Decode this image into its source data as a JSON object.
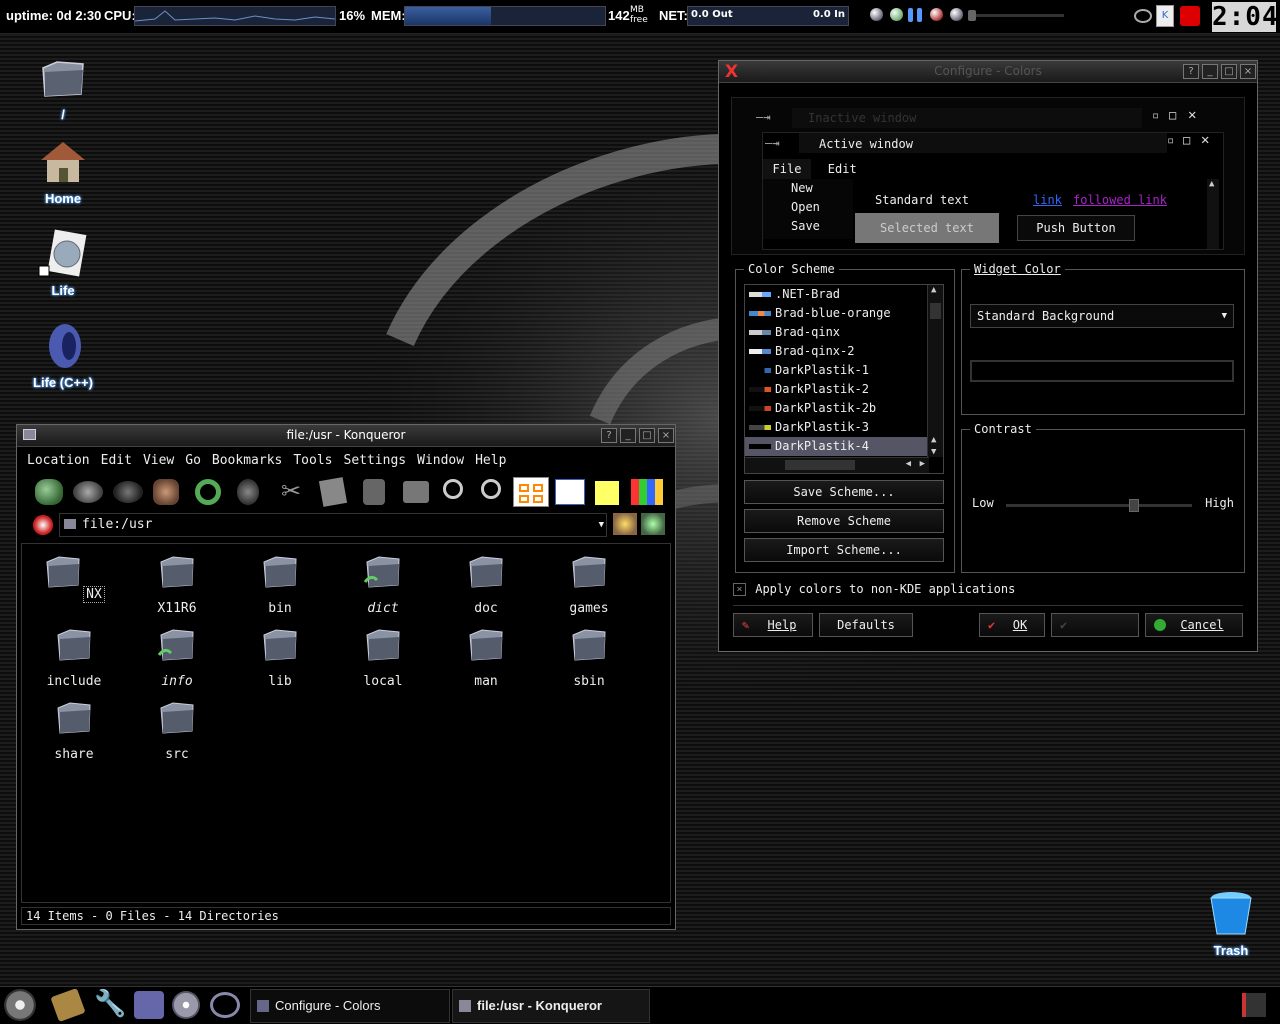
{
  "topbar": {
    "uptime": "uptime: 0d 2:30",
    "cpu_label": "CPU:",
    "cpu_value": "16%",
    "cpu_fraction": 0.16,
    "mem_label": "MEM:",
    "mem_value": "142",
    "mem_unit_top": "MB",
    "mem_unit_bottom": "free",
    "net_label": "NET:",
    "net_out": "0.0 Out",
    "net_in": "0.0 In",
    "clock": "2:04"
  },
  "desktop_icons": [
    {
      "label": "/",
      "icon": "folder-icon"
    },
    {
      "label": "Home",
      "icon": "home-icon"
    },
    {
      "label": "Life",
      "icon": "html-file-icon"
    },
    {
      "label": "Life (C++)",
      "icon": "program-icon"
    },
    {
      "label": "Trash",
      "icon": "trash-icon"
    }
  ],
  "konqueror": {
    "title": "file:/usr - Konqueror",
    "menu": [
      "Location",
      "Edit",
      "View",
      "Go",
      "Bookmarks",
      "Tools",
      "Settings",
      "Window",
      "Help"
    ],
    "location": "file:/usr",
    "folders": [
      "NX",
      "X11R6",
      "bin",
      "dict",
      "doc",
      "games",
      "include",
      "info",
      "lib",
      "local",
      "man",
      "sbin",
      "share",
      "src"
    ],
    "status": "14 Items - 0 Files - 14 Directories"
  },
  "colors": {
    "title": "Configure - Colors",
    "preview": {
      "inactive_window": "Inactive window",
      "active_window": "Active window",
      "menu": [
        "File",
        "Edit"
      ],
      "menu_items": [
        "New",
        "Open",
        "Save"
      ],
      "standard_text": "Standard text",
      "selected_text": "Selected text",
      "link": "link",
      "followed_link": "followed link",
      "push_button": "Push Button"
    },
    "scheme_group": "Color Scheme",
    "schemes": [
      ".NET-Brad",
      "Brad-blue-orange",
      "Brad-qinx",
      "Brad-qinx-2",
      "DarkPlastik-1",
      "DarkPlastik-2",
      "DarkPlastik-2b",
      "DarkPlastik-3",
      "DarkPlastik-4"
    ],
    "save_scheme": "Save Scheme...",
    "remove_scheme": "Remove Scheme",
    "import_scheme": "Import Scheme...",
    "widget_group": "Widget Color",
    "widget_select": "Standard Background",
    "contrast_group": "Contrast",
    "contrast_low": "Low",
    "contrast_high": "High",
    "contrast_value": 0.7,
    "apply_label": "Apply colors to non-KDE applications",
    "help": "Help",
    "defaults": "Defaults",
    "ok": "OK",
    "cancel": "Cancel"
  },
  "taskbar": {
    "tasks": [
      "Configure - Colors",
      "file:/usr - Konqueror"
    ]
  },
  "accent": "#3a5fa0"
}
